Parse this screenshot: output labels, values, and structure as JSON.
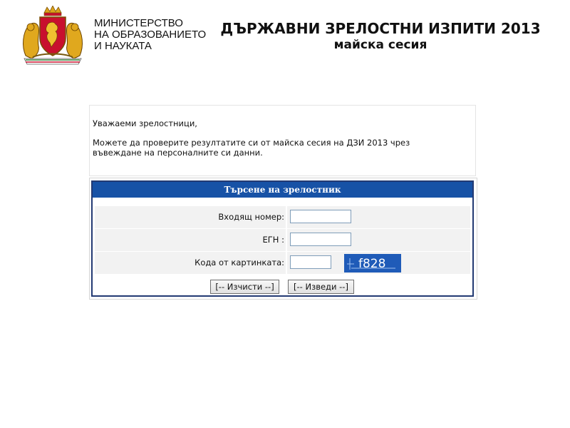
{
  "header": {
    "ministry_lines": [
      "МИНИСТЕРСТВО",
      "НА ОБРАЗОВАНИЕТО",
      "И НАУКАТА"
    ],
    "title": "ДЪРЖАВНИ ЗРЕЛОСТНИ ИЗПИТИ 2013",
    "subtitle": "майска сесия",
    "coat_of_arms_icon": "coat-of-arms-icon"
  },
  "message": {
    "greeting": "Уважаеми зрелостници,",
    "text": "Можете да проверите резултатите си от майска сесия на ДЗИ 2013 чрез въвеждане на персоналните си данни."
  },
  "search": {
    "title": "Търсене на зрелостник",
    "fields": {
      "incoming_number": {
        "label": "Входящ номер:",
        "value": ""
      },
      "egn": {
        "label": "ЕГН :",
        "value": ""
      },
      "captcha_code": {
        "label": "Кода от картинката:",
        "value": ""
      }
    },
    "captcha_text": "f828",
    "clear_label": "[-- Изчисти --]",
    "submit_label": "[-- Изведи --]"
  },
  "colors": {
    "panel_header": "#1752a6",
    "panel_border": "#233a73",
    "row_background": "#f2f2f2",
    "captcha_background": "#1f5bb8"
  }
}
